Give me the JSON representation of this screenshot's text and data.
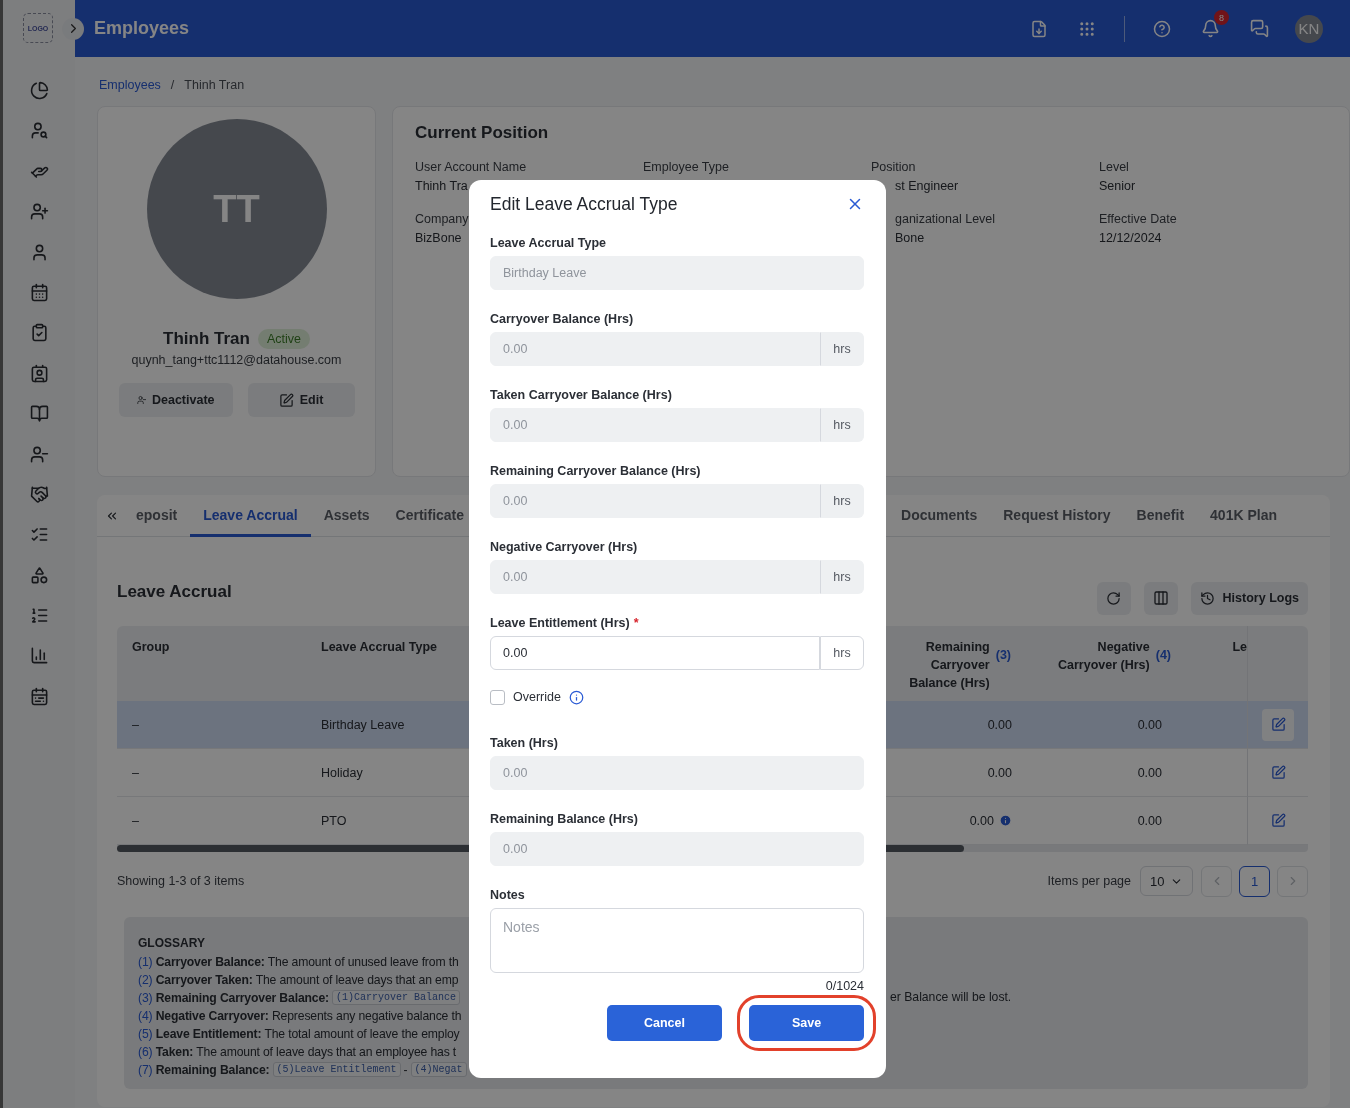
{
  "header": {
    "logo": "LOGO",
    "title": "Employees",
    "notification_count": "8",
    "avatar": "KN"
  },
  "breadcrumb": {
    "items": [
      {
        "label": "Employees",
        "link": true
      },
      {
        "label": "Thinh Tran",
        "link": false
      }
    ],
    "separator": "/"
  },
  "profile": {
    "initials": "TT",
    "name": "Thinh Tran",
    "status": "Active",
    "email": "quynh_tang+ttc1112@datahouse.com",
    "buttons": [
      {
        "label": "Deactivate",
        "kind": "deactivate"
      },
      {
        "label": "Edit",
        "kind": "edit"
      }
    ]
  },
  "current_position": {
    "title": "Current Position",
    "columns": [
      {
        "items": [
          {
            "label": "User Account Name",
            "value": "Thinh Tra"
          },
          {
            "label": "Company",
            "value": "BizBone"
          }
        ]
      },
      {
        "items": [
          {
            "label": "Employee Type"
          }
        ]
      },
      {
        "items": [
          {
            "label": "Position",
            "value": "st Engineer"
          },
          {
            "label": "ganizational Level",
            "value": "Bone"
          }
        ]
      },
      {
        "items": [
          {
            "label": "Level",
            "value": "Senior"
          },
          {
            "label": "Effective Date",
            "value": "12/12/2024"
          }
        ]
      }
    ]
  },
  "tabs": {
    "before_dialog": [
      {
        "label": "eposit",
        "selected": false
      },
      {
        "label": "Leave Accrual",
        "selected": true
      },
      {
        "label": "Assets",
        "selected": false
      },
      {
        "label": "Certificate",
        "selected": false
      }
    ],
    "after_dialog": [
      {
        "label": "Documents",
        "selected": false
      },
      {
        "label": "Request History",
        "selected": false
      },
      {
        "label": "Benefit",
        "selected": false
      },
      {
        "label": "401K Plan",
        "selected": false
      }
    ]
  },
  "leave_accrual": {
    "title": "Leave Accrual",
    "history_button": "History Logs",
    "table": {
      "columns": [
        {
          "label": "Group"
        },
        {
          "label": "Leave Accrual Type"
        },
        {
          "label": "Remaining Carryover Balance (Hrs)",
          "note": "(3)"
        },
        {
          "label": "Negative Carryover (Hrs)",
          "note": "(4)"
        },
        {
          "label": "Le"
        }
      ],
      "rows": [
        {
          "group": "–",
          "type": "Birthday Leave",
          "remaining": "0.00",
          "negative": "0.00",
          "info": false,
          "selected": true
        },
        {
          "group": "–",
          "type": "Holiday",
          "remaining": "0.00",
          "negative": "0.00",
          "info": false,
          "selected": false
        },
        {
          "group": "–",
          "type": "PTO",
          "remaining": "0.00",
          "negative": "0.00",
          "info": true,
          "selected": false
        }
      ]
    },
    "pagination": {
      "summary": "Showing 1-3 of 3 items",
      "per_page_label": "Items per page",
      "per_page": "10",
      "pages": [
        {
          "label": "1",
          "selected": true
        }
      ]
    }
  },
  "glossary": {
    "title": "GLOSSARY",
    "lines": [
      {
        "num": "(1)",
        "term": "Carryover Balance:",
        "parts": [
          {
            "kind": "text",
            "text": "The amount of unused leave from th"
          }
        ]
      },
      {
        "num": "(2)",
        "term": "Carryover Taken:",
        "parts": [
          {
            "kind": "text",
            "text": "The amount of leave days that an emp"
          }
        ]
      },
      {
        "num": "(3)",
        "term": "Remaining Carryover Balance:",
        "parts": [
          {
            "kind": "code",
            "text": "(1)Carryover Balance"
          }
        ],
        "tail": "er Balance will be lost."
      },
      {
        "num": "(4)",
        "term": "Negative Carryover:",
        "parts": [
          {
            "kind": "text",
            "text": "Represents any negative balance th"
          }
        ]
      },
      {
        "num": "(5)",
        "term": "Leave Entitlement:",
        "parts": [
          {
            "kind": "text",
            "text": "The total amount of leave the employ"
          }
        ]
      },
      {
        "num": "(6)",
        "term": "Taken:",
        "parts": [
          {
            "kind": "text",
            "text": "The amount of leave days that an employee has t"
          }
        ]
      },
      {
        "num": "(7)",
        "term": "Remaining Balance:",
        "parts": [
          {
            "kind": "code",
            "text": "(5)Leave Entitlement"
          },
          {
            "kind": "op",
            "text": "-"
          },
          {
            "kind": "code",
            "text": "(4)Negat"
          }
        ]
      }
    ]
  },
  "dialog": {
    "title": "Edit Leave Accrual Type",
    "fields": [
      {
        "kind": "input",
        "label": "Leave Accrual Type",
        "value": "Birthday Leave",
        "disabled": true
      },
      {
        "kind": "input",
        "label": "Carryover Balance (Hrs)",
        "value": "0.00",
        "unit": "hrs",
        "disabled": true
      },
      {
        "kind": "input",
        "label": "Taken Carryover Balance (Hrs)",
        "value": "0.00",
        "unit": "hrs",
        "disabled": true
      },
      {
        "kind": "input",
        "label": "Remaining Carryover Balance (Hrs)",
        "value": "0.00",
        "unit": "hrs",
        "disabled": true
      },
      {
        "kind": "input",
        "label": "Negative Carryover (Hrs)",
        "value": "0.00",
        "unit": "hrs",
        "disabled": true
      },
      {
        "kind": "input",
        "label": "Leave Entitlement (Hrs)",
        "required_mark": "*",
        "value": "0.00",
        "unit": "hrs",
        "disabled": false
      },
      {
        "kind": "checkbox",
        "label": "Override",
        "checked": false
      },
      {
        "kind": "input",
        "label": "Taken (Hrs)",
        "value": "0.00",
        "disabled": true
      },
      {
        "kind": "input",
        "label": "Remaining Balance (Hrs)",
        "value": "0.00",
        "disabled": true
      },
      {
        "kind": "textarea",
        "label": "Notes",
        "placeholder": "Notes",
        "counter": "0/1024"
      }
    ],
    "buttons": [
      {
        "label": "Cancel",
        "highlighted": false
      },
      {
        "label": "Save",
        "highlighted": true
      }
    ]
  }
}
